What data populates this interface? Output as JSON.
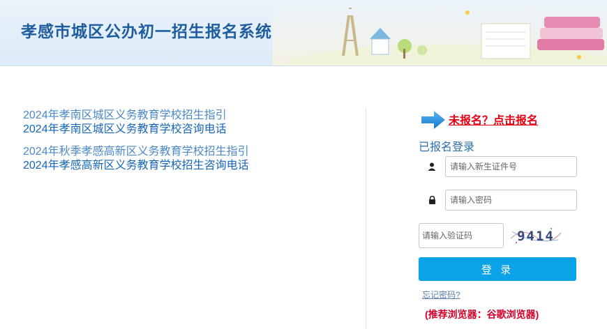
{
  "header": {
    "title": "孝感市城区公办初一招生报名系统"
  },
  "links": {
    "group1": [
      "2024年孝南区城区义务教育学校招生指引",
      "2024年孝南区城区义务教育学校咨询电话"
    ],
    "group2": [
      "2024年秋季孝感高新区义务教育学校招生指引",
      "2024年孝感高新区义务教育学校招生咨询电话"
    ]
  },
  "login": {
    "register_link": "未报名？点击报名",
    "heading": "已报名登录",
    "id_placeholder": "请输入新生证件号",
    "password_placeholder": "请输入密码",
    "captcha_placeholder": "请输入验证码",
    "captcha_text": "9414",
    "submit_label": "登 录",
    "forgot_link": "忘记密码?",
    "browser_note": "(推荐浏览器：谷歌浏览器)"
  },
  "colors": {
    "title": "#1f5d9e",
    "button": "#0aa3e8",
    "register": "#e60012"
  },
  "icons": [
    "arrow-right-icon",
    "user-icon",
    "lock-icon"
  ]
}
